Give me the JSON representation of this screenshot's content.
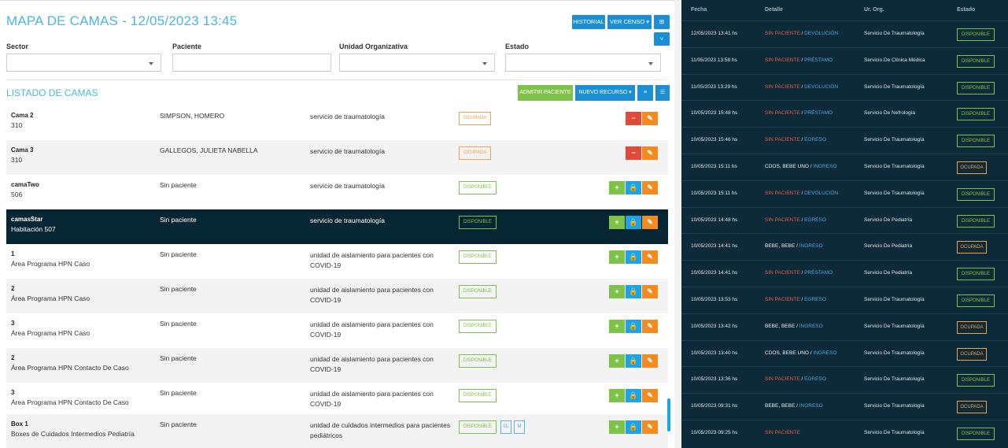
{
  "header": {
    "title": "MAPA DE CAMAS - 12/05/2023 13:45",
    "buttons": [
      "HISTORIAL",
      "VER CENSO ▾",
      "⊞"
    ]
  },
  "filters": [
    {
      "label": "Sector",
      "value": ""
    },
    {
      "label": "Paciente",
      "value": ""
    },
    {
      "label": "Unidad Organizativa",
      "value": ""
    },
    {
      "label": "Estado",
      "value": ""
    }
  ],
  "list": {
    "title": "LISTADO DE CAMAS",
    "buttons": [
      "ADMITIR PACIENTE",
      "NUEVO RECURSO ▾"
    ],
    "rows": [
      {
        "name": "Cama 2",
        "sub": "310",
        "paciente": "SIMPSON, HOMERO",
        "unidad": "servicio de traumatología",
        "estado": "OCUPADA",
        "tipo": "oc",
        "actions": [
          "−",
          "✎"
        ],
        "extra": []
      },
      {
        "name": "Cama 3",
        "sub": "310",
        "paciente": "GALLEGOS, JULIETA NABELLA",
        "unidad": "servicio de traumatología",
        "estado": "OCUPADA",
        "tipo": "oc",
        "actions": [
          "−",
          "✎"
        ],
        "extra": []
      },
      {
        "name": "camaTwo",
        "sub": "506",
        "paciente": "Sin paciente",
        "unidad": "servicio de traumatología",
        "estado": "DISPONIBLE",
        "tipo": "di",
        "actions": [
          "+",
          "🔒",
          "✎"
        ],
        "extra": []
      },
      {
        "name": "camasStar",
        "sub": "Habitación 507",
        "paciente": "Sin paciente",
        "unidad": "servicio de traumatología",
        "estado": "DISPONIBLE",
        "tipo": "di",
        "actions": [
          "+",
          "🔒",
          "✎"
        ],
        "extra": []
      },
      {
        "name": "1",
        "sub": "Área Programa HPN Caso",
        "paciente": "Sin paciente",
        "unidad": "unidad de aislamiento para pacientes con COVID-19",
        "estado": "DISPONIBLE",
        "tipo": "di",
        "actions": [
          "+",
          "🔒",
          "✎"
        ],
        "extra": []
      },
      {
        "name": "2",
        "sub": "Área Programa HPN Caso",
        "paciente": "Sin paciente",
        "unidad": "unidad de aislamiento para pacientes con COVID-19",
        "estado": "DISPONIBLE",
        "tipo": "di",
        "actions": [
          "+",
          "🔒",
          "✎"
        ],
        "extra": []
      },
      {
        "name": "3",
        "sub": "Área Programa HPN Caso",
        "paciente": "Sin paciente",
        "unidad": "unidad de aislamiento para pacientes con COVID-19",
        "estado": "DISPONIBLE",
        "tipo": "di",
        "actions": [
          "+",
          "🔒",
          "✎"
        ],
        "extra": []
      },
      {
        "name": "2",
        "sub": "Área Programa HPN Contacto De Caso",
        "paciente": "Sin paciente",
        "unidad": "unidad de aislamiento para pacientes con COVID-19",
        "estado": "DISPONIBLE",
        "tipo": "di",
        "actions": [
          "+",
          "🔒",
          "✎"
        ],
        "extra": []
      },
      {
        "name": "3",
        "sub": "Área Programa HPN Contacto De Caso",
        "paciente": "Sin paciente",
        "unidad": "unidad de aislamiento para pacientes con COVID-19",
        "estado": "DISPONIBLE",
        "tipo": "di",
        "actions": [
          "+",
          "🔒",
          "✎"
        ],
        "extra": []
      },
      {
        "name": "Box 1",
        "sub": "Boxes de Cuidados Intermedios Pediatría",
        "paciente": "Sin paciente",
        "unidad": "unidad de cuidados intermedios para pacientes pediátricos",
        "estado": "DISPONIBLE",
        "tipo": "di",
        "actions": [
          "+",
          "🔒",
          "✎"
        ],
        "extra": [
          "O₂",
          "M"
        ]
      }
    ]
  },
  "history": {
    "headers": [
      "Fecha",
      "Detalle",
      "Ur. Org.",
      "Estado"
    ],
    "rows": [
      {
        "fecha": "12/05/2023 13:41 hs",
        "who": "SIN PACIENTE",
        "act": "DEVOLUCIÓN",
        "org": "Servicio De Traumatología",
        "estado": "DISPONIBLE"
      },
      {
        "fecha": "11/05/2023 13:58 hs",
        "who": "SIN PACIENTE",
        "act": "PRÉSTAMO",
        "org": "Servicio De Clínica Médica",
        "estado": "DISPONIBLE"
      },
      {
        "fecha": "11/05/2023 13:29 hs",
        "who": "SIN PACIENTE",
        "act": "DEVOLUCIÓN",
        "org": "Servicio De Traumatología",
        "estado": "DISPONIBLE"
      },
      {
        "fecha": "10/05/2023 15:48 hs",
        "who": "SIN PACIENTE",
        "act": "PRÉSTAMO",
        "org": "Servicio De Nefrología",
        "estado": "DISPONIBLE"
      },
      {
        "fecha": "10/05/2023 15:46 hs",
        "who": "SIN PACIENTE",
        "act": "EGRESO",
        "org": "Servicio De Traumatología",
        "estado": "DISPONIBLE"
      },
      {
        "fecha": "10/05/2023 15:11 hs",
        "who": "CDOS, BEBE UNO",
        "act": "INGRESO",
        "org": "Servicio De Traumatología",
        "estado": "OCUPADA"
      },
      {
        "fecha": "10/05/2023 15:11 hs",
        "who": "SIN PACIENTE",
        "act": "DEVOLUCIÓN",
        "org": "Servicio De Traumatología",
        "estado": "DISPONIBLE"
      },
      {
        "fecha": "10/05/2023 14:48 hs",
        "who": "SIN PACIENTE",
        "act": "EGRESO",
        "org": "Servicio De Pediatría",
        "estado": "DISPONIBLE"
      },
      {
        "fecha": "10/05/2023 14:41 hs",
        "who": "BEBE, BEBE",
        "act": "INGRESO",
        "org": "Servicio De Pediatría",
        "estado": "OCUPADA"
      },
      {
        "fecha": "10/05/2023 14:41 hs",
        "who": "SIN PACIENTE",
        "act": "PRÉSTAMO",
        "org": "Servicio De Pediatría",
        "estado": "DISPONIBLE"
      },
      {
        "fecha": "10/05/2023 13:53 hs",
        "who": "SIN PACIENTE",
        "act": "EGRESO",
        "org": "Servicio De Traumatología",
        "estado": "DISPONIBLE"
      },
      {
        "fecha": "10/05/2023 13:42 hs",
        "who": "BEBE, BEBE",
        "act": "INGRESO",
        "org": "Servicio De Traumatología",
        "estado": "OCUPADA"
      },
      {
        "fecha": "10/05/2023 13:40 hs",
        "who": "CDOS, BEBE UNO",
        "act": "INGRESO",
        "org": "Servicio De Traumatología",
        "estado": "OCUPADA"
      },
      {
        "fecha": "10/05/2023 13:36 hs",
        "who": "SIN PACIENTE",
        "act": "EGRESO",
        "org": "Servicio De Traumatología",
        "estado": "DISPONIBLE"
      },
      {
        "fecha": "10/05/2023 09:31 hs",
        "who": "BEBE, BEBE",
        "act": "INGRESO",
        "org": "Servicio De Traumatología",
        "estado": "OCUPADA"
      },
      {
        "fecha": "10/05/2023 09:25 hs",
        "who": "SIN PACIENTE",
        "act": "",
        "org": "Servicio De Traumatología",
        "estado": "DISPONIBLE"
      }
    ]
  },
  "colors": {
    "accent": "#4cb5e6",
    "ocupada": "#f5a04a",
    "disponible": "#7ec24a",
    "panel": "#0d2a38"
  }
}
